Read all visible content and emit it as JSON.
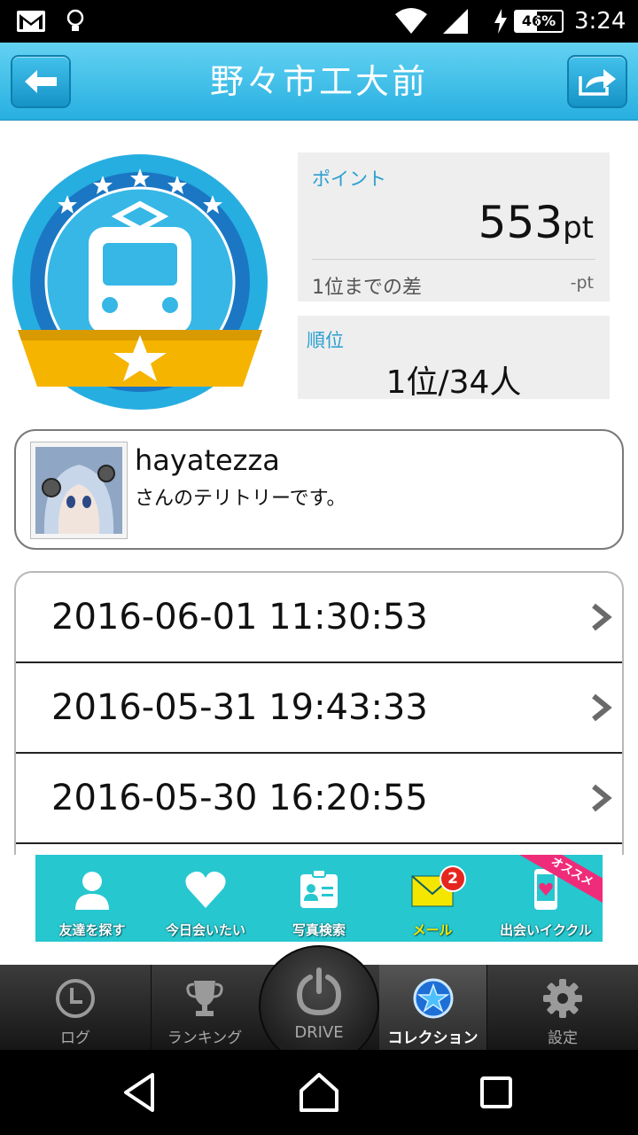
{
  "status_bar": {
    "battery": "46%",
    "time": "3:24"
  },
  "header": {
    "title": "野々市工大前"
  },
  "points": {
    "label": "ポイント",
    "value": "553",
    "unit": "pt",
    "diff_label": "1位までの差",
    "diff_value": "-pt"
  },
  "rank": {
    "label": "順位",
    "value": "1位/34人"
  },
  "owner": {
    "name": "hayatezza",
    "desc": "さんのテリトリーです。"
  },
  "history": [
    {
      "timestamp": "2016-06-01 11:30:53"
    },
    {
      "timestamp": "2016-05-31 19:43:33"
    },
    {
      "timestamp": "2016-05-30 16:20:55"
    }
  ],
  "ad": {
    "items": [
      {
        "label": "友達を探す",
        "icon": "person-icon"
      },
      {
        "label": "今日会いたい",
        "icon": "heart-icon"
      },
      {
        "label": "写真検索",
        "icon": "id-card-icon"
      },
      {
        "label": "メール",
        "icon": "mail-icon"
      },
      {
        "label": "出会いイククル",
        "icon": "phone-icon"
      }
    ],
    "mail_count": "2",
    "ribbon": "オススメ"
  },
  "tabs": {
    "log": "ログ",
    "ranking": "ランキング",
    "drive": "DRIVE",
    "collection": "コレクション",
    "settings": "設定"
  },
  "colors": {
    "accent": "#27afe0",
    "badge_blue": "#1d8ad0",
    "ribbon_yellow": "#f5b400",
    "ad_bg": "#26c7cf"
  }
}
